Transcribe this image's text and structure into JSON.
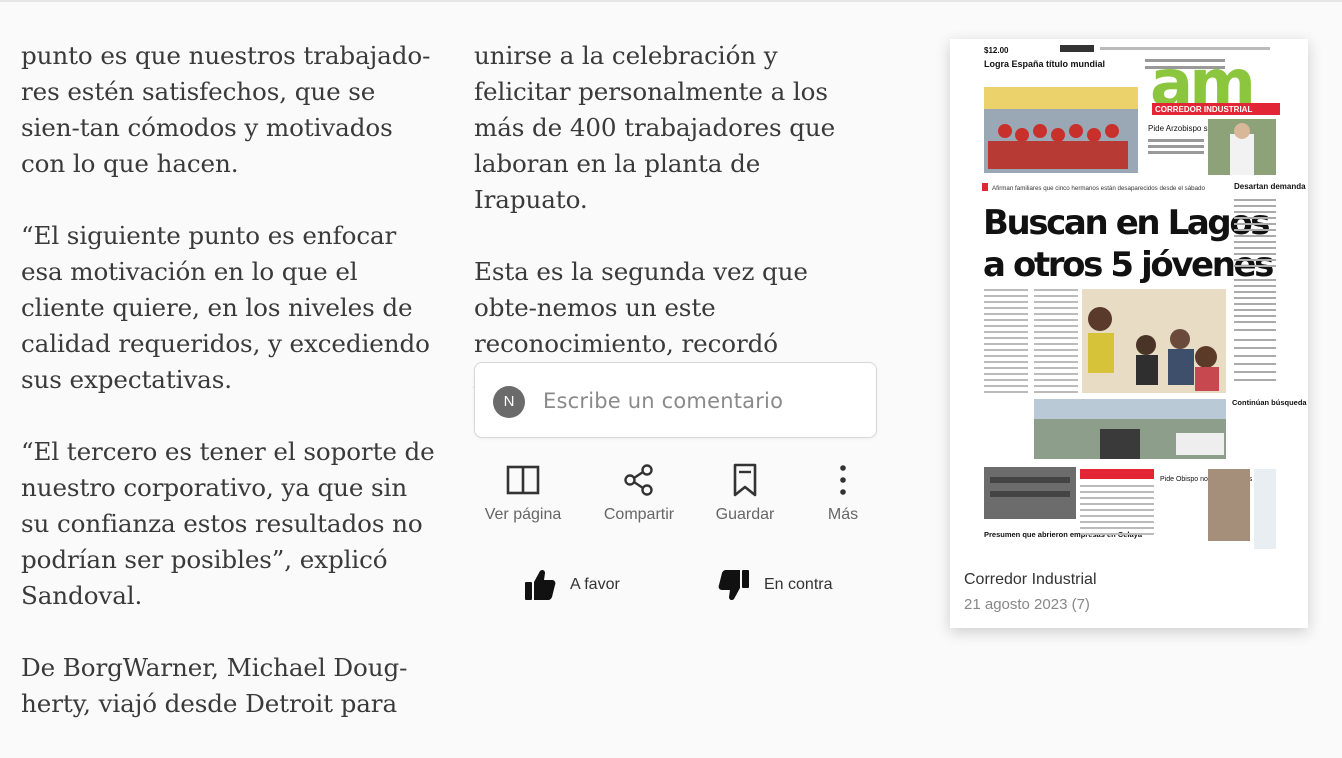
{
  "article": {
    "left_paragraphs": [
      "punto es que nuestros trabajado-res estén satisfechos, que se sien-tan cómodos y motivados con lo que hacen.",
      "“El siguiente punto es enfocar esa motivación en lo que el cliente quiere, en los niveles de calidad requeridos, y excediendo sus expectativas.",
      "“El tercero es tener el soporte de nuestro corporativo, ya que sin su confianza estos resultados no podrían ser posibles”, explicó Sandoval.",
      "De BorgWarner, Michael Doug-herty, viajó desde Detroit para"
    ],
    "mid_paragraphs": [
      "unirse a la celebración y felicitar personalmente a los más de 400 trabajadores que laboran en la planta de Irapuato.",
      "Esta es la segunda vez que obte-nemos un este reconocimiento, recordó Alfredo García."
    ]
  },
  "comment": {
    "avatar_letter": "N",
    "placeholder": "Escribe un comentario"
  },
  "actions": {
    "view_page": "Ver página",
    "share": "Compartir",
    "save": "Guardar",
    "more": "Más"
  },
  "votes": {
    "up": "A favor",
    "down": "En contra"
  },
  "edition": {
    "masthead": "am",
    "section_banner": "CORREDOR INDUSTRIAL",
    "price": "$12.00",
    "teaser_left": "Logra España título mundial",
    "teaser_right": "Pide Arzobispo superar pleitos",
    "kicker": "Afirman familiares que cinco hermanos están desaparecidos desde el sábado",
    "headline_line1": "Buscan en Lagos",
    "headline_line2": "a otros 5 jóvenes",
    "side_title": "Desartan demanda",
    "side_title2": "Continúan búsqueda",
    "bottom_story": "Presumen que abrieron empresas en Celaya",
    "bottom_story2": "Pide Obispo no abandonarlos",
    "caption_title": "Corredor Industrial",
    "caption_date": "21 agosto 2023  (7)"
  },
  "colors": {
    "masthead_green": "#8cc63f",
    "banner_red": "#e32636",
    "headline_black": "#111111"
  }
}
